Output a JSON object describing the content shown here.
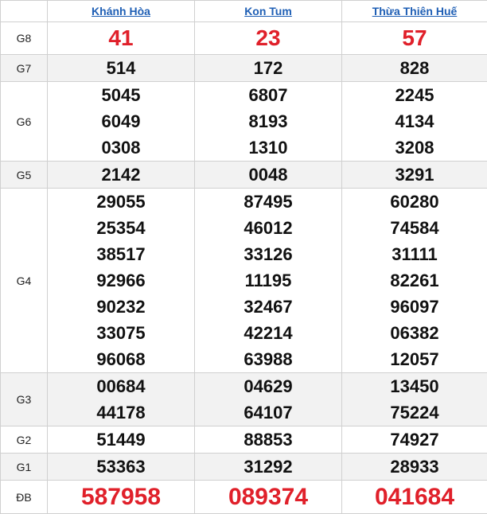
{
  "provinces": [
    "Khánh Hòa",
    "Kon Tum",
    "Thừa Thiên Huế"
  ],
  "colors": {
    "link": "#1f5fb5",
    "highlight": "#e0202a",
    "shade": "#f2f2f2"
  },
  "rows": [
    {
      "label": "G8",
      "values": [
        [
          "41"
        ],
        [
          "23"
        ],
        [
          "57"
        ]
      ]
    },
    {
      "label": "G7",
      "values": [
        [
          "514"
        ],
        [
          "172"
        ],
        [
          "828"
        ]
      ]
    },
    {
      "label": "G6",
      "values": [
        [
          "5045",
          "6049",
          "0308"
        ],
        [
          "6807",
          "8193",
          "1310"
        ],
        [
          "2245",
          "4134",
          "3208"
        ]
      ]
    },
    {
      "label": "G5",
      "values": [
        [
          "2142"
        ],
        [
          "0048"
        ],
        [
          "3291"
        ]
      ]
    },
    {
      "label": "G4",
      "values": [
        [
          "29055",
          "25354",
          "38517",
          "92966",
          "90232",
          "33075",
          "96068"
        ],
        [
          "87495",
          "46012",
          "33126",
          "11195",
          "32467",
          "42214",
          "63988"
        ],
        [
          "60280",
          "74584",
          "31111",
          "82261",
          "96097",
          "06382",
          "12057"
        ]
      ]
    },
    {
      "label": "G3",
      "values": [
        [
          "00684",
          "44178"
        ],
        [
          "04629",
          "64107"
        ],
        [
          "13450",
          "75224"
        ]
      ]
    },
    {
      "label": "G2",
      "values": [
        [
          "51449"
        ],
        [
          "88853"
        ],
        [
          "74927"
        ]
      ]
    },
    {
      "label": "G1",
      "values": [
        [
          "53363"
        ],
        [
          "31292"
        ],
        [
          "28933"
        ]
      ]
    },
    {
      "label": "ĐB",
      "values": [
        [
          "587958"
        ],
        [
          "089374"
        ],
        [
          "041684"
        ]
      ]
    }
  ]
}
